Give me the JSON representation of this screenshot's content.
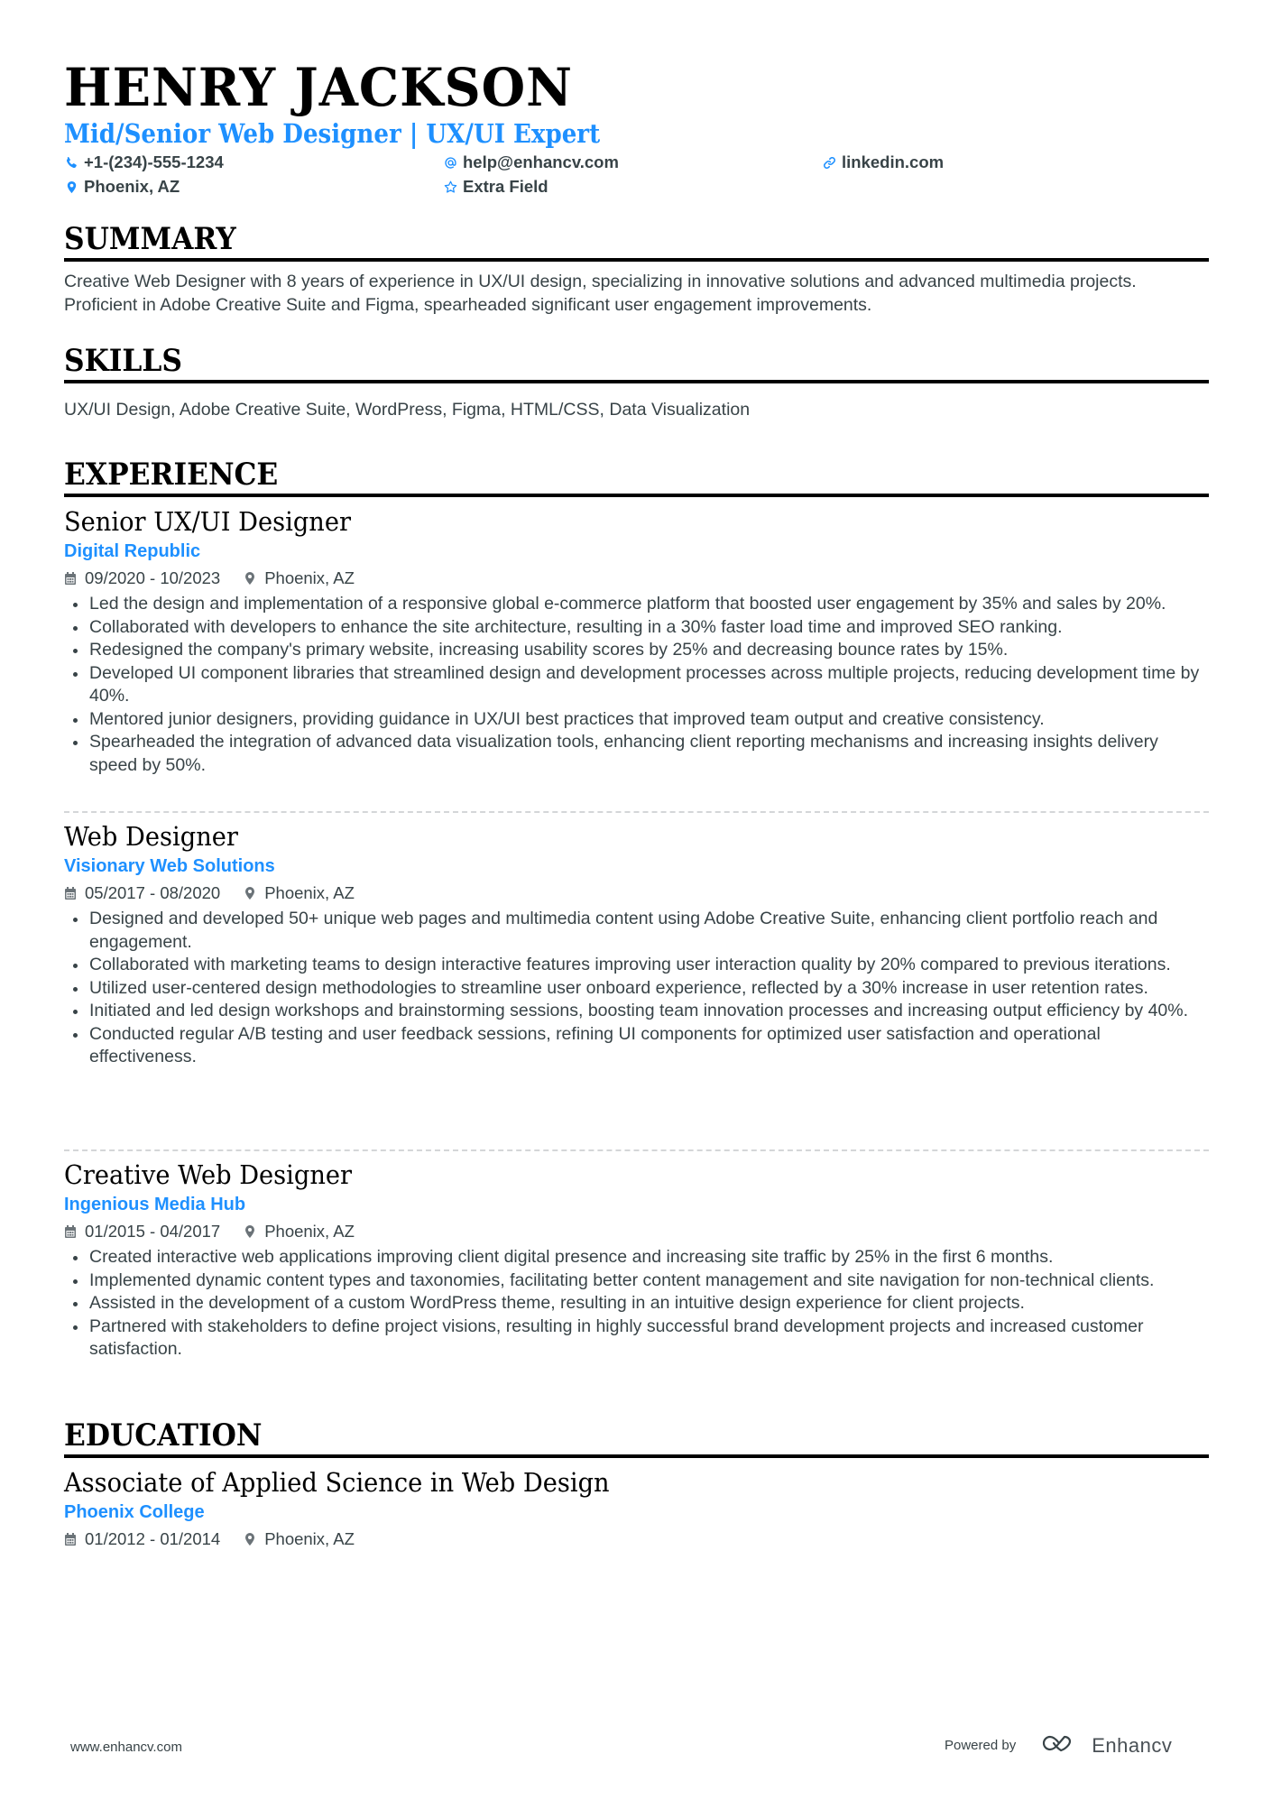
{
  "header": {
    "name": "HENRY JACKSON",
    "headline": "Mid/Senior Web Designer | UX/UI Expert",
    "contacts": [
      {
        "icon": "phone-icon",
        "text": "+1-(234)-555-1234"
      },
      {
        "icon": "at-icon",
        "text": "help@enhancv.com"
      },
      {
        "icon": "link-icon",
        "text": "linkedin.com"
      },
      {
        "icon": "location-pin-icon",
        "text": "Phoenix, AZ"
      },
      {
        "icon": "star-icon",
        "text": "Extra Field"
      }
    ]
  },
  "colors": {
    "accent": "#1e90ff",
    "text": "#384347",
    "heading": "#000000",
    "icon_gray": "#6b7378",
    "separator": "#d4d6d8"
  },
  "summary": {
    "title": "SUMMARY",
    "text": "Creative Web Designer with 8 years of experience in UX/UI design, specializing in innovative solutions and advanced multimedia projects. Proficient in Adobe Creative Suite and Figma, spearheaded significant user engagement improvements."
  },
  "skills": {
    "title": "SKILLS",
    "text": "UX/UI Design, Adobe Creative Suite, WordPress, Figma, HTML/CSS, Data Visualization"
  },
  "experience": {
    "title": "EXPERIENCE",
    "jobs": [
      {
        "title": "Senior UX/UI Designer",
        "company": "Digital Republic",
        "dates": "09/2020 - 10/2023",
        "location": "Phoenix, AZ",
        "bullets": [
          "Led the design and implementation of a responsive global e-commerce platform that boosted user engagement by 35% and sales by 20%.",
          "Collaborated with developers to enhance the site architecture, resulting in a 30% faster load time and improved SEO ranking.",
          "Redesigned the company's primary website, increasing usability scores by 25% and decreasing bounce rates by 15%.",
          "Developed UI component libraries that streamlined design and development processes across multiple projects, reducing development time by 40%.",
          "Mentored junior designers, providing guidance in UX/UI best practices that improved team output and creative consistency.",
          "Spearheaded the integration of advanced data visualization tools, enhancing client reporting mechanisms and increasing insights delivery speed by 50%."
        ]
      },
      {
        "title": "Web Designer",
        "company": "Visionary Web Solutions",
        "dates": "05/2017 - 08/2020",
        "location": "Phoenix, AZ",
        "bullets": [
          "Designed and developed 50+ unique web pages and multimedia content using Adobe Creative Suite, enhancing client portfolio reach and engagement.",
          "Collaborated with marketing teams to design interactive features improving user interaction quality by 20% compared to previous iterations.",
          "Utilized user-centered design methodologies to streamline user onboard experience, reflected by a 30% increase in user retention rates.",
          "Initiated and led design workshops and brainstorming sessions, boosting team innovation processes and increasing output efficiency by 40%.",
          "Conducted regular A/B testing and user feedback sessions, refining UI components for optimized user satisfaction and operational effectiveness."
        ]
      },
      {
        "title": "Creative Web Designer",
        "company": "Ingenious Media Hub",
        "dates": "01/2015 - 04/2017",
        "location": "Phoenix, AZ",
        "bullets": [
          "Created interactive web applications improving client digital presence and increasing site traffic by 25% in the first 6 months.",
          "Implemented dynamic content types and taxonomies, facilitating better content management and site navigation for non-technical clients.",
          "Assisted in the development of a custom WordPress theme, resulting in an intuitive design experience for client projects.",
          "Partnered with stakeholders to define project visions, resulting in highly successful brand development projects and increased customer satisfaction."
        ]
      }
    ]
  },
  "education": {
    "title": "EDUCATION",
    "items": [
      {
        "degree": "Associate of Applied Science in Web Design",
        "school": "Phoenix College",
        "dates": "01/2012 - 01/2014",
        "location": "Phoenix, AZ"
      }
    ]
  },
  "footer": {
    "website": "www.enhancv.com",
    "powered_by": "Powered by",
    "brand": "Enhancv"
  }
}
